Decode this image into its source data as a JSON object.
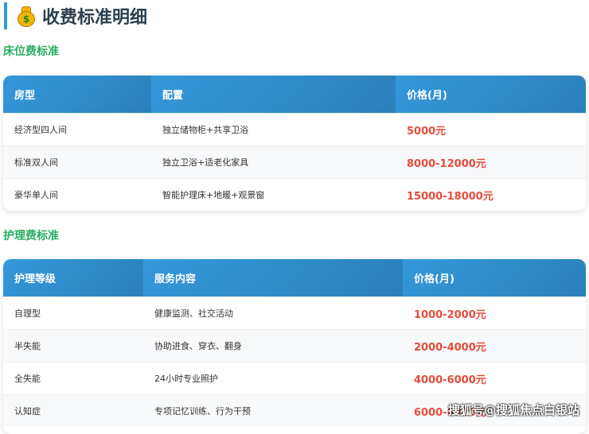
{
  "title": "收费标准明细",
  "bed": {
    "title": "床位费标准",
    "headers": [
      "房型",
      "配置",
      "价格(月)"
    ],
    "rows": [
      [
        "经济型四人间",
        "独立储物柜+共享卫浴",
        "5000元"
      ],
      [
        "标准双人间",
        "独立卫浴+适老化家具",
        "8000-12000元"
      ],
      [
        "豪华单人间",
        "智能护理床+地暖+观景窗",
        "15000-18000元"
      ]
    ]
  },
  "care": {
    "title": "护理费标准",
    "headers": [
      "护理等级",
      "服务内容",
      "价格(月)"
    ],
    "rows": [
      [
        "自理型",
        "健康监测、社交活动",
        "1000-2000元"
      ],
      [
        "半失能",
        "协助进食、穿衣、翻身",
        "2000-4000元"
      ],
      [
        "全失能",
        "24小时专业照护",
        "4000-6000元"
      ],
      [
        "认知症",
        "专项记忆训练、行为干预",
        "6000-8000元"
      ]
    ]
  },
  "watermark": "搜狐号@搜狐焦点白银站"
}
